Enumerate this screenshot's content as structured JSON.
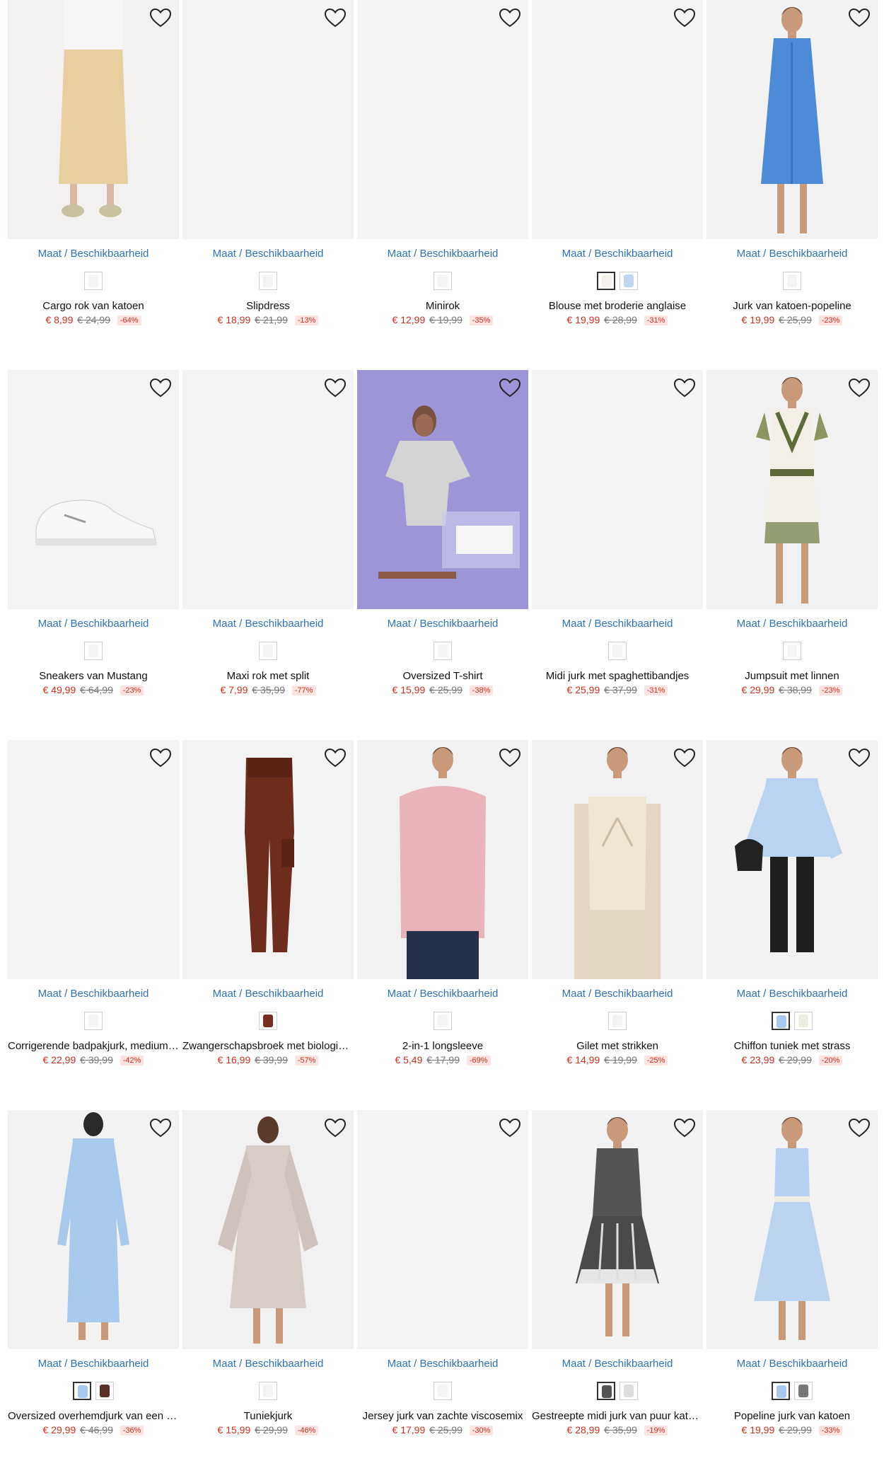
{
  "size_link_label": "Maat / Beschikbaarheid",
  "colors": {
    "link": "#2f72b5",
    "sale_price": "#d1301f",
    "discount_bg": "#fde4e1",
    "image_bg": "#f2f2f2"
  },
  "products": [
    {
      "title": "Cargo rok van katoen",
      "price": "€ 8,99",
      "old_price": "€ 24,99",
      "discount": "-64%",
      "image": "woman-beige-maxi-skirt",
      "swatches": [
        "#f4f4f4"
      ],
      "bg": "#f3f1ef",
      "photo": "skirt"
    },
    {
      "title": "Slipdress",
      "price": "€ 18,99",
      "old_price": "€ 21,99",
      "discount": "-13%",
      "image": "blank",
      "swatches": [
        "#f4f4f4"
      ],
      "bg": "#f4f4f4",
      "photo": "none"
    },
    {
      "title": "Minirok",
      "price": "€ 12,99",
      "old_price": "€ 19,99",
      "discount": "-35%",
      "image": "blank",
      "swatches": [
        "#f4f4f4"
      ],
      "bg": "#f4f4f4",
      "photo": "none"
    },
    {
      "title": "Blouse met broderie anglaise",
      "price": "€ 19,99",
      "old_price": "€ 28,99",
      "discount": "-31%",
      "image": "blank",
      "swatches": [
        "#f4f0ea",
        "#bfd6ef"
      ],
      "bg": "#f4f4f4",
      "photo": "none"
    },
    {
      "title": "Jurk van katoen-popeline",
      "price": "€ 19,99",
      "old_price": "€ 25,99",
      "discount": "-23%",
      "image": "woman-blue-shirt-dress",
      "swatches": [
        "#f4f4f4"
      ],
      "bg": "#f2f2f2",
      "photo": "dress"
    },
    {
      "title": "Sneakers van Mustang",
      "price": "€ 49,99",
      "old_price": "€ 64,99",
      "discount": "-23%",
      "image": "white-sneaker",
      "swatches": [
        "#f4f4f4"
      ],
      "bg": "#f3f3f3",
      "photo": "shoe"
    },
    {
      "title": "Maxi rok met split",
      "price": "€ 7,99",
      "old_price": "€ 35,99",
      "discount": "-77%",
      "image": "blank",
      "swatches": [
        "#f4f4f4"
      ],
      "bg": "#f4f4f4",
      "photo": "none"
    },
    {
      "title": "Oversized T-shirt",
      "price": "€ 15,99",
      "old_price": "€ 25,99",
      "discount": "-38%",
      "image": "woman-grey-tshirt-lilac",
      "swatches": [
        "#f4f4f4"
      ],
      "bg": "#9c96d8",
      "photo": "tshirt"
    },
    {
      "title": "Midi jurk met spaghettibandjes",
      "price": "€ 25,99",
      "old_price": "€ 37,99",
      "discount": "-31%",
      "image": "blank",
      "swatches": [
        "#f4f4f4"
      ],
      "bg": "#f4f4f4",
      "photo": "none"
    },
    {
      "title": "Jumpsuit met linnen",
      "price": "€ 29,99",
      "old_price": "€ 38,99",
      "discount": "-23%",
      "image": "woman-printed-jumpsuit",
      "swatches": [
        "#f4f4f4"
      ],
      "bg": "#f1f1f1",
      "photo": "jumpsuit"
    },
    {
      "title": "Corrigerende badpakjurk, medium …",
      "price": "€ 22,99",
      "old_price": "€ 39,99",
      "discount": "-42%",
      "image": "blank",
      "swatches": [
        "#f4f4f4"
      ],
      "bg": "#f4f4f4",
      "photo": "none"
    },
    {
      "title": "Zwangerschapsbroek met biologisc…",
      "price": "€ 16,99",
      "old_price": "€ 39,99",
      "discount": "-57%",
      "image": "brown-cargo-pants",
      "swatches": [
        "#7a2e22"
      ],
      "bg": "#f3f3f3",
      "photo": "pants"
    },
    {
      "title": "2-in-1 longsleeve",
      "price": "€ 5,49",
      "old_price": "€ 17,99",
      "discount": "-69%",
      "image": "woman-pink-longsleeve",
      "swatches": [
        "#f4f4f4"
      ],
      "bg": "#f1f1f1",
      "photo": "pink"
    },
    {
      "title": "Gilet met strikken",
      "price": "€ 14,99",
      "old_price": "€ 19,99",
      "discount": "-25%",
      "image": "woman-cream-gilet",
      "swatches": [
        "#f4f4f4"
      ],
      "bg": "#f1f1f1",
      "photo": "gilet"
    },
    {
      "title": "Chiffon tuniek met strass",
      "price": "€ 23,99",
      "old_price": "€ 29,99",
      "discount": "-20%",
      "image": "woman-blue-tunic",
      "swatches": [
        "#a9c8ee",
        "#efece2"
      ],
      "bg": "#f2f2f2",
      "photo": "tunic"
    },
    {
      "title": "Oversized overhemdjurk van een vi…",
      "price": "€ 29,99",
      "old_price": "€ 46,99",
      "discount": "-36%",
      "image": "woman-light-blue-shirt-dress",
      "swatches": [
        "#a9c8ee",
        "#5a3028"
      ],
      "bg": "#f2f2f2",
      "photo": "longdress"
    },
    {
      "title": "Tuniekjurk",
      "price": "€ 15,99",
      "old_price": "€ 29,99",
      "discount": "-46%",
      "image": "woman-printed-tunic-dress",
      "swatches": [
        "#f4f4f4"
      ],
      "bg": "#f1f1f1",
      "photo": "tunicdress"
    },
    {
      "title": "Jersey jurk van zachte viscosemix",
      "price": "€ 17,99",
      "old_price": "€ 25,99",
      "discount": "-30%",
      "image": "blank",
      "swatches": [
        "#f4f4f4"
      ],
      "bg": "#f4f4f4",
      "photo": "none"
    },
    {
      "title": "Gestreepte midi jurk van puur katoen",
      "price": "€ 28,99",
      "old_price": "€ 35,99",
      "discount": "-19%",
      "image": "woman-striped-midi-dress",
      "swatches": [
        "#555555",
        "#dddddd"
      ],
      "bg": "#f2f2f2",
      "photo": "striped"
    },
    {
      "title": "Popeline jurk van katoen",
      "price": "€ 19,99",
      "old_price": "€ 29,99",
      "discount": "-33%",
      "image": "woman-gingham-dress",
      "swatches": [
        "#a9c8ee",
        "#777777"
      ],
      "bg": "#f2f2f2",
      "photo": "gingham"
    }
  ]
}
